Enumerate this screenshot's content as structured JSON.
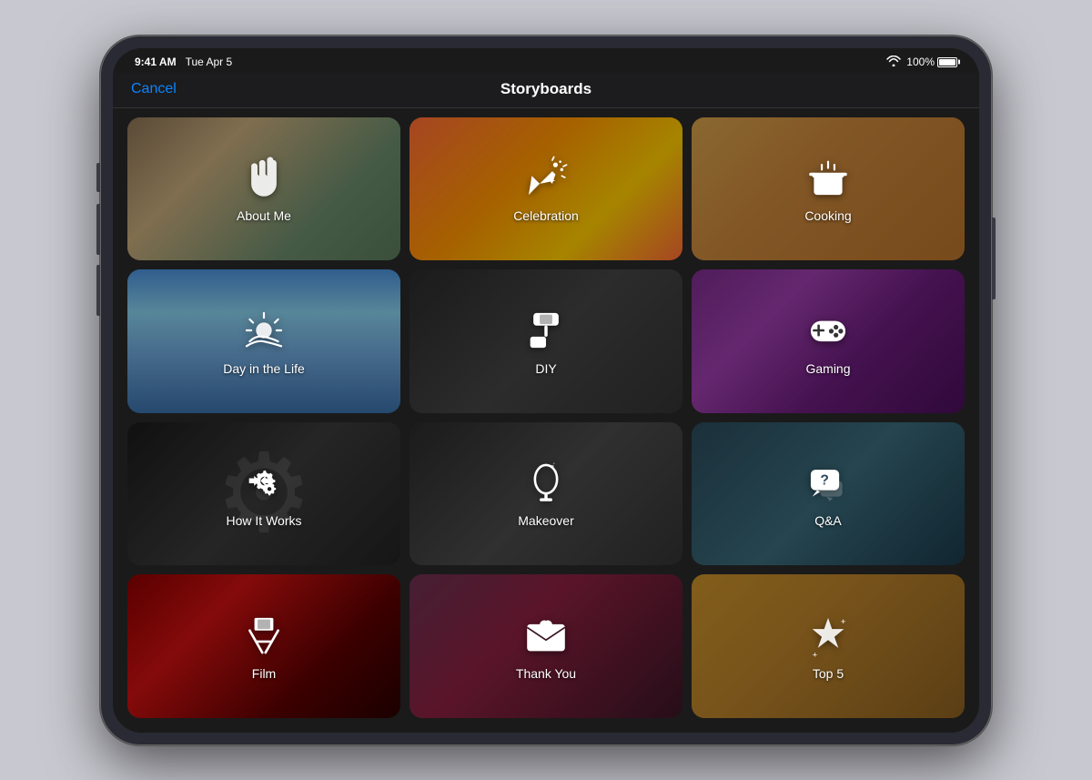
{
  "device": {
    "status_bar": {
      "time": "9:41 AM",
      "date": "Tue Apr 5",
      "battery": "100%"
    },
    "nav": {
      "title": "Storyboards",
      "cancel": "Cancel"
    },
    "grid": {
      "items": [
        {
          "id": "about-me",
          "label": "About Me",
          "icon": "hand-wave",
          "bg_class": "bg-about-me"
        },
        {
          "id": "celebration",
          "label": "Celebration",
          "icon": "party-popper",
          "bg_class": "bg-celebration"
        },
        {
          "id": "cooking",
          "label": "Cooking",
          "icon": "cooking-pot",
          "bg_class": "bg-cooking"
        },
        {
          "id": "day-in-life",
          "label": "Day in the Life",
          "icon": "sunrise",
          "bg_class": "bg-day-in-life"
        },
        {
          "id": "diy",
          "label": "DIY",
          "icon": "paint-roller",
          "bg_class": "bg-diy"
        },
        {
          "id": "gaming",
          "label": "Gaming",
          "icon": "gamepad",
          "bg_class": "bg-gaming"
        },
        {
          "id": "how-it-works",
          "label": "How It Works",
          "icon": "gears",
          "bg_class": "bg-how-it-works"
        },
        {
          "id": "makeover",
          "label": "Makeover",
          "icon": "mirror",
          "bg_class": "bg-makeover"
        },
        {
          "id": "qa",
          "label": "Q&A",
          "icon": "qa-bubble",
          "bg_class": "bg-qa"
        },
        {
          "id": "film",
          "label": "Film",
          "icon": "director-chair",
          "bg_class": "bg-film"
        },
        {
          "id": "thank-you",
          "label": "Thank You",
          "icon": "envelope-heart",
          "bg_class": "bg-thank-you"
        },
        {
          "id": "top5",
          "label": "Top 5",
          "icon": "star",
          "bg_class": "bg-top5"
        }
      ]
    }
  }
}
